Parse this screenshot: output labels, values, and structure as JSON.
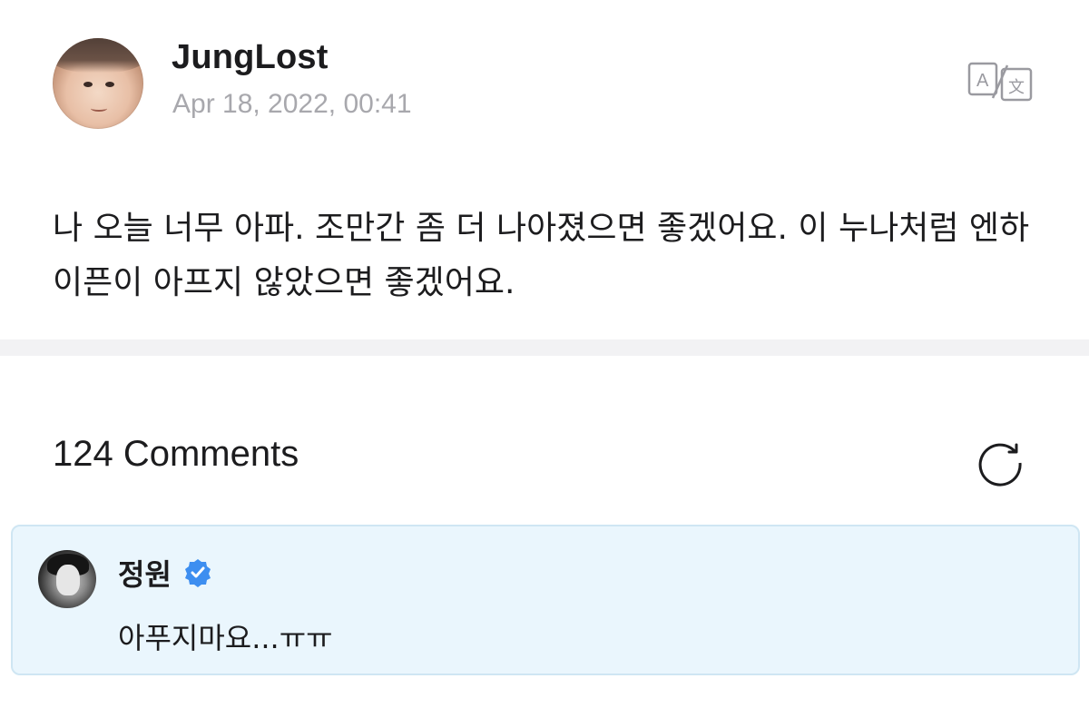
{
  "post": {
    "author": "JungLost",
    "timestamp": "Apr 18, 2022, 00:41",
    "body": "나 오늘 너무 아파. 조만간 좀 더 나아졌으면 좋겠어요. 이 누나처럼 엔하이픈이 아프지 않았으면 좋겠어요.",
    "avatar_icon": "user-avatar-icon",
    "translate_icon": "translate-icon"
  },
  "comments": {
    "count_label": "124 Comments",
    "refresh_icon": "refresh-icon",
    "items": [
      {
        "author": "정원",
        "verified": true,
        "verified_color": "#3d8ef0",
        "text": "아푸지마요...ㅠㅠ"
      }
    ]
  },
  "colors": {
    "comment_bg": "#eaf6fd",
    "comment_border": "#cfe6f3",
    "timestamp": "#a8a8ad",
    "separator": "#f2f2f4"
  }
}
